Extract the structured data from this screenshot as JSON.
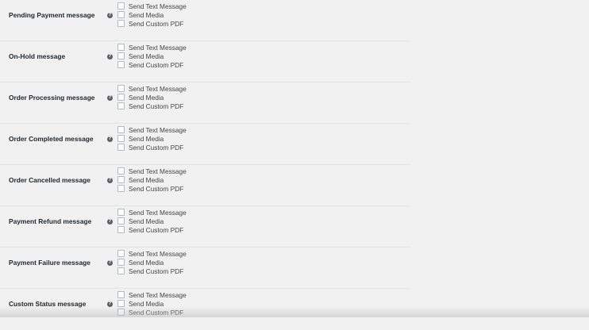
{
  "settings": {
    "rows": [
      {
        "label": "Pending Payment message",
        "options": [
          "Send Text Message",
          "Send Media",
          "Send Custom PDF"
        ]
      },
      {
        "label": "On-Hold message",
        "options": [
          "Send Text Message",
          "Send Media",
          "Send Custom PDF"
        ]
      },
      {
        "label": "Order Processing message",
        "options": [
          "Send Text Message",
          "Send Media",
          "Send Custom PDF"
        ]
      },
      {
        "label": "Order Completed message",
        "options": [
          "Send Text Message",
          "Send Media",
          "Send Custom PDF"
        ]
      },
      {
        "label": "Order Cancelled message",
        "options": [
          "Send Text Message",
          "Send Media",
          "Send Custom PDF"
        ]
      },
      {
        "label": "Payment Refund message",
        "options": [
          "Send Text Message",
          "Send Media",
          "Send Custom PDF"
        ]
      },
      {
        "label": "Payment Failure message",
        "options": [
          "Send Text Message",
          "Send Media",
          "Send Custom PDF"
        ]
      },
      {
        "label": "Custom Status message",
        "options": [
          "Send Text Message",
          "Send Media",
          "Send Custom PDF"
        ]
      }
    ],
    "help_glyph": "?",
    "help_icon_name": "help-icon"
  }
}
